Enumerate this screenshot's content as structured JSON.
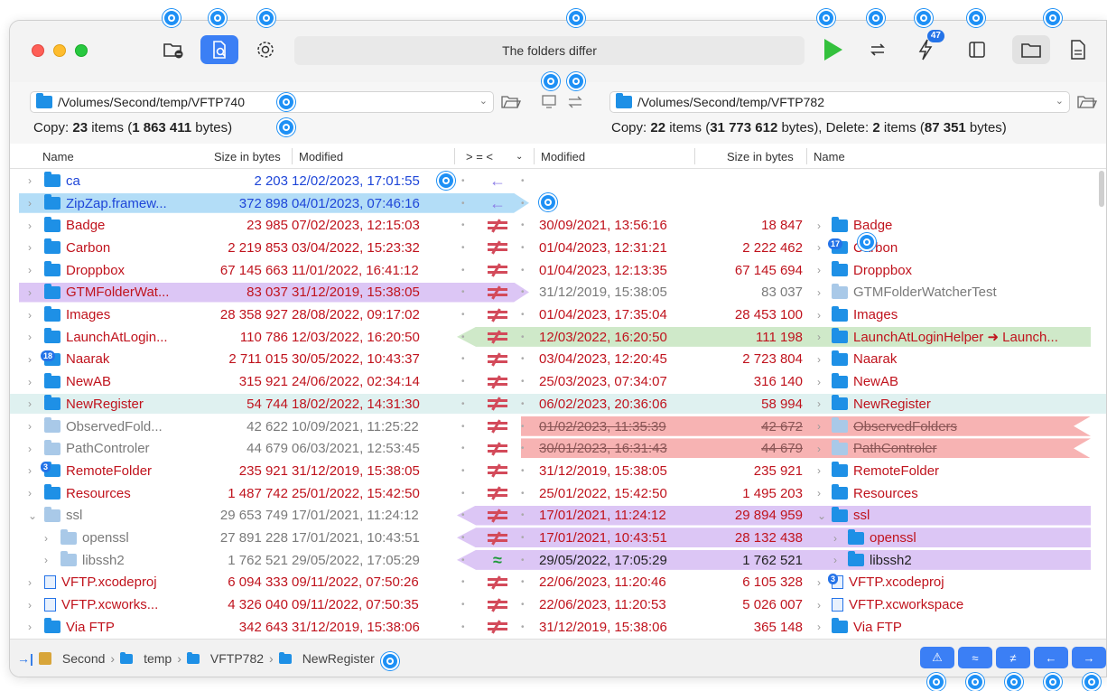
{
  "toolbar": {
    "status_text": "The folders differ",
    "queue_badge": "47",
    "icons": [
      "folder-minus-icon",
      "compare-icon",
      "gear-icon",
      "play-icon",
      "sync-icon",
      "bolt-icon",
      "sidebar-icon",
      "folder-icon",
      "document-icon"
    ]
  },
  "left": {
    "path": "/Volumes/Second/temp/VFTP740",
    "summary": {
      "copy_label": "Copy:",
      "items": "23",
      "items_word": "items (",
      "bytes": "1 863 411",
      "bytes_word": " bytes)"
    }
  },
  "right": {
    "path": "/Volumes/Second/temp/VFTP782",
    "summary": {
      "copy_label": "Copy:",
      "items": "22",
      "items_word": "items (",
      "bytes": "31 773 612",
      "bytes_word": " bytes), Delete:",
      "del_items": "2",
      "del_items_word": "items (",
      "del_bytes": "87 351",
      "del_bytes_word": " bytes)"
    }
  },
  "columns": {
    "name": "Name",
    "size": "Size in bytes",
    "modified": "Modified",
    "compare": "> = <",
    "r_modified": "Modified",
    "r_size": "Size in bytes",
    "r_name": "Name"
  },
  "rows": [
    {
      "lname": "ca",
      "lsize": "2 203",
      "lmod": "12/02/2023, 17:01:55",
      "action": "←",
      "rmod": "",
      "rsize": "",
      "rname": "",
      "lcolor": "blue",
      "rcolor": "",
      "hl": ""
    },
    {
      "lname": "ZipZap.framew...",
      "lsize": "372 898",
      "lmod": "04/01/2023, 07:46:16",
      "action": "←",
      "rmod": "",
      "rsize": "",
      "rname": "",
      "lcolor": "blue",
      "rcolor": "",
      "hl": "blue-l"
    },
    {
      "lname": "Badge",
      "lsize": "23 985",
      "lmod": "07/02/2023, 12:15:03",
      "action": "≠",
      "rmod": "30/09/2021, 13:56:16",
      "rsize": "18 847",
      "rname": "Badge",
      "lcolor": "red",
      "rcolor": "red",
      "hl": ""
    },
    {
      "lname": "Carbon",
      "lsize": "2 219 853",
      "lmod": "03/04/2022, 15:23:32",
      "action": "≠",
      "rmod": "01/04/2023, 12:31:21",
      "rsize": "2 222 462",
      "rname": "Carbon",
      "lcolor": "red",
      "rcolor": "red",
      "hl": "",
      "rbadge": "17"
    },
    {
      "lname": "Droppbox",
      "lsize": "67 145 663",
      "lmod": "11/01/2022, 16:41:12",
      "action": "≠",
      "rmod": "01/04/2023, 12:13:35",
      "rsize": "67 145 694",
      "rname": "Droppbox",
      "lcolor": "red",
      "rcolor": "red",
      "hl": ""
    },
    {
      "lname": "GTMFolderWat...",
      "lsize": "83 037",
      "lmod": "31/12/2019, 15:38:05",
      "action": "≠",
      "rmod": "31/12/2019, 15:38:05",
      "rsize": "83 037",
      "rname": "GTMFolderWatcherTest",
      "lcolor": "red",
      "rcolor": "gray",
      "hl": "purple-l"
    },
    {
      "lname": "Images",
      "lsize": "28 358 927",
      "lmod": "28/08/2022, 09:17:02",
      "action": "≠",
      "rmod": "01/04/2023, 17:35:04",
      "rsize": "28 453 100",
      "rname": "Images",
      "lcolor": "red",
      "rcolor": "red",
      "hl": ""
    },
    {
      "lname": "LaunchAtLogin...",
      "lsize": "110 786",
      "lmod": "12/03/2022, 16:20:50",
      "action": "≠",
      "rmod": "12/03/2022, 16:20:50",
      "rsize": "111 198",
      "rname": "LaunchAtLoginHelper ➜ Launch...",
      "lcolor": "red",
      "rcolor": "red",
      "hl": "green-r"
    },
    {
      "lname": "Naarak",
      "lsize": "2 711 015",
      "lmod": "30/05/2022, 10:43:37",
      "action": "≠",
      "rmod": "03/04/2023, 12:20:45",
      "rsize": "2 723 804",
      "rname": "Naarak",
      "lcolor": "red",
      "rcolor": "red",
      "hl": "",
      "lbadge": "18"
    },
    {
      "lname": "NewAB",
      "lsize": "315 921",
      "lmod": "24/06/2022, 02:34:14",
      "action": "≠",
      "rmod": "25/03/2023, 07:34:07",
      "rsize": "316 140",
      "rname": "NewAB",
      "lcolor": "red",
      "rcolor": "red",
      "hl": ""
    },
    {
      "lname": "NewRegister",
      "lsize": "54 744",
      "lmod": "18/02/2022, 14:31:30",
      "action": "≠",
      "rmod": "06/02/2023, 20:36:06",
      "rsize": "58 994",
      "rname": "NewRegister",
      "lcolor": "red",
      "rcolor": "red",
      "hl": "teal"
    },
    {
      "lname": "ObservedFold...",
      "lsize": "42 622",
      "lmod": "10/09/2021, 11:25:22",
      "action": "≠",
      "rmod": "01/02/2023, 11:35:39",
      "rsize": "42 672",
      "rname": "ObservedFolders",
      "lcolor": "gray",
      "rcolor": "strike",
      "hl": "red-r"
    },
    {
      "lname": "PathControler",
      "lsize": "44 679",
      "lmod": "06/03/2021, 12:53:45",
      "action": "≠",
      "rmod": "30/01/2023, 16:31:43",
      "rsize": "44 679",
      "rname": "PathControler",
      "lcolor": "gray",
      "rcolor": "strike",
      "hl": "red-r"
    },
    {
      "lname": "RemoteFolder",
      "lsize": "235 921",
      "lmod": "31/12/2019, 15:38:05",
      "action": "≠",
      "rmod": "31/12/2019, 15:38:05",
      "rsize": "235 921",
      "rname": "RemoteFolder",
      "lcolor": "red",
      "rcolor": "red",
      "hl": "",
      "lbadge": "3"
    },
    {
      "lname": "Resources",
      "lsize": "1 487 742",
      "lmod": "25/01/2022, 15:42:50",
      "action": "≠",
      "rmod": "25/01/2022, 15:42:50",
      "rsize": "1 495 203",
      "rname": "Resources",
      "lcolor": "red",
      "rcolor": "red",
      "hl": ""
    },
    {
      "lname": "ssl",
      "lsize": "29 653 749",
      "lmod": "17/01/2021, 11:24:12",
      "action": "≠",
      "rmod": "17/01/2021, 11:24:12",
      "rsize": "29 894 959",
      "rname": "ssl",
      "lcolor": "gray",
      "rcolor": "red",
      "hl": "purple-r",
      "expanded": true
    },
    {
      "lname": "openssl",
      "lsize": "27 891 228",
      "lmod": "17/01/2021, 10:43:51",
      "action": "≠",
      "rmod": "17/01/2021, 10:43:51",
      "rsize": "28 132 438",
      "rname": "openssl",
      "lcolor": "gray",
      "rcolor": "red",
      "hl": "purple-r",
      "indent": 1
    },
    {
      "lname": "libssh2",
      "lsize": "1 762 521",
      "lmod": "29/05/2022, 17:05:29",
      "action": "≈",
      "rmod": "29/05/2022, 17:05:29",
      "rsize": "1 762 521",
      "rname": "libssh2",
      "lcolor": "gray",
      "rcolor": "dark",
      "hl": "purple-r",
      "indent": 1
    },
    {
      "lname": "VFTP.xcodeproj",
      "lsize": "6 094 333",
      "lmod": "09/11/2022, 07:50:26",
      "action": "≠",
      "rmod": "22/06/2023, 11:20:46",
      "rsize": "6 105 328",
      "rname": "VFTP.xcodeproj",
      "lcolor": "red",
      "rcolor": "red",
      "hl": "",
      "rbadge": "3",
      "file": true
    },
    {
      "lname": "VFTP.xcworks...",
      "lsize": "4 326 040",
      "lmod": "09/11/2022, 07:50:35",
      "action": "≠",
      "rmod": "22/06/2023, 11:20:53",
      "rsize": "5 026 007",
      "rname": "VFTP.xcworkspace",
      "lcolor": "red",
      "rcolor": "red",
      "hl": "",
      "file": true
    },
    {
      "lname": "Via FTP",
      "lsize": "342 643",
      "lmod": "31/12/2019, 15:38:06",
      "action": "≠",
      "rmod": "31/12/2019, 15:38:06",
      "rsize": "365 148",
      "rname": "Via FTP",
      "lcolor": "red",
      "rcolor": "red",
      "hl": ""
    }
  ],
  "breadcrumb": [
    "Second",
    "temp",
    "VFTP782",
    "NewRegister"
  ],
  "bottom_buttons": [
    "⚠",
    "≈",
    "≠",
    "←",
    "→"
  ]
}
